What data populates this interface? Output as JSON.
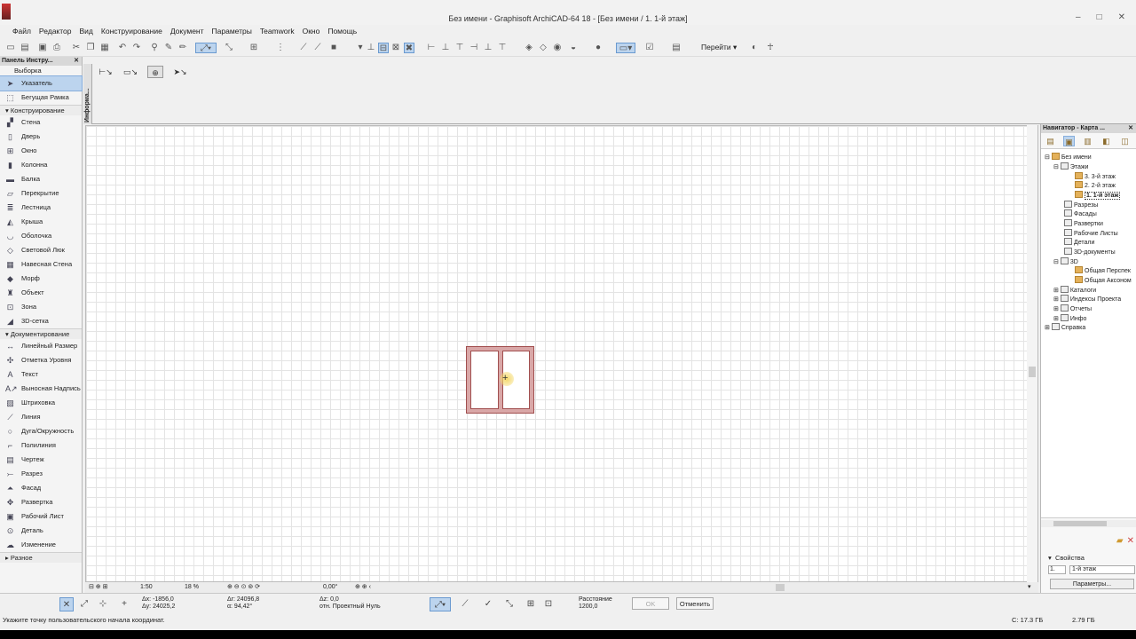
{
  "window": {
    "title": "Без имени - Graphisoft ArchiCAD-64 18 - [Без имени / 1. 1-й этаж]",
    "controls": [
      "–",
      "□",
      "✕"
    ]
  },
  "menu": [
    "Файл",
    "Редактор",
    "Вид",
    "Конструирование",
    "Документ",
    "Параметры",
    "Teamwork",
    "Окно",
    "Помощь"
  ],
  "toolbar": {
    "goto_label": "Перейти ▾"
  },
  "toolbox": {
    "header": "Панель Инстру...",
    "selection_group": "Выборка",
    "selection_items": [
      "Указатель",
      "Бегущая Рамка"
    ],
    "construction_group": "Конструирование",
    "construction_items": [
      "Стена",
      "Дверь",
      "Окно",
      "Колонна",
      "Балка",
      "Перекрытие",
      "Лестница",
      "Крыша",
      "Оболочка",
      "Световой Люк",
      "Навесная Стена",
      "Морф",
      "Объект",
      "Зона",
      "3D-сетка"
    ],
    "documentation_group": "Документирование",
    "documentation_items": [
      "Линейный Размер",
      "Отметка Уровня",
      "Текст",
      "Выносная Надпись",
      "Штриховка",
      "Линия",
      "Дуга/Окружность",
      "Полилиния",
      "Чертеж",
      "Разрез",
      "Фасад",
      "Развертка",
      "Рабочий Лист",
      "Деталь",
      "Изменение"
    ],
    "misc_group": "Разное"
  },
  "infobox": {
    "tab_label": "Информа..."
  },
  "canvas_bar": {
    "scale": "1:50",
    "zoom": "18 %",
    "angle": "0,00°"
  },
  "navigator": {
    "header": "Навигатор - Карта ...",
    "tree": [
      {
        "label": "Без имени",
        "level": 0
      },
      {
        "label": "Этажи",
        "level": 1
      },
      {
        "label": "3. 3-й этаж",
        "level": 2
      },
      {
        "label": "2. 2-й этаж",
        "level": 2
      },
      {
        "label": "1. 1-й этаж",
        "level": 2,
        "selected": true
      },
      {
        "label": "Разрезы",
        "level": 1
      },
      {
        "label": "Фасады",
        "level": 1
      },
      {
        "label": "Развертки",
        "level": 1
      },
      {
        "label": "Рабочие Листы",
        "level": 1
      },
      {
        "label": "Детали",
        "level": 1
      },
      {
        "label": "3D-документы",
        "level": 1
      },
      {
        "label": "3D",
        "level": 1
      },
      {
        "label": "Общая Перспек",
        "level": 2
      },
      {
        "label": "Общая Аксоном",
        "level": 2
      },
      {
        "label": "Каталоги",
        "level": 1
      },
      {
        "label": "Индексы Проекта",
        "level": 1
      },
      {
        "label": "Отчеты",
        "level": 1
      },
      {
        "label": "Инфо",
        "level": 1
      },
      {
        "label": "Справка",
        "level": 0
      }
    ],
    "properties_label": "Свойства",
    "prop_number": "1.",
    "prop_name": "1-й этаж",
    "params_button": "Параметры..."
  },
  "controlbar": {
    "dx": "Δx: -1856,0",
    "dy": "Δy: 24025,2",
    "dr": "Δr: 24096,8",
    "da": "α: 94,42°",
    "dz": "Δz: 0,0",
    "ref": "отн. Проектный Нуль",
    "distance_label": "Расстояние",
    "distance_value": "1200,0",
    "ok": "OK",
    "cancel": "Отменить"
  },
  "status": {
    "hint": "Укажите точку пользовательского начала координат.",
    "disk": "C: 17.3 ГБ",
    "memory": "2.79 ГБ"
  }
}
